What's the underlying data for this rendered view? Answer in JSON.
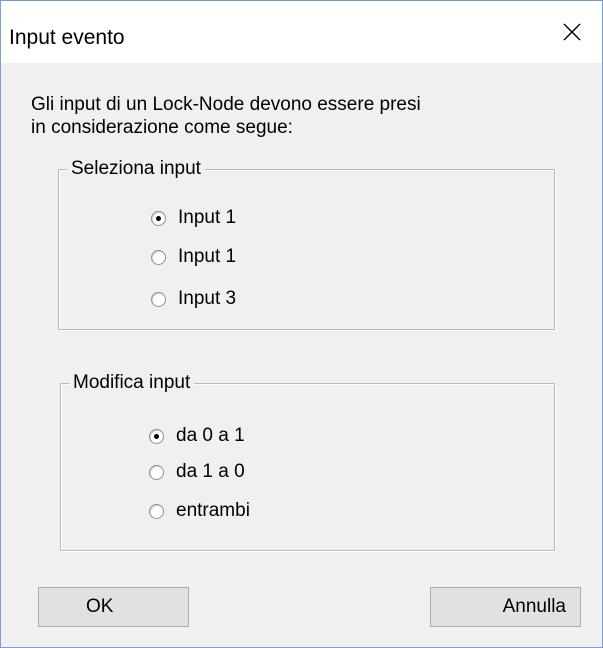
{
  "window": {
    "title": "Input evento",
    "close_icon": "close-icon"
  },
  "description": {
    "line1": "Gli input di un Lock-Node devono essere presi",
    "line2": "in considerazione come segue:"
  },
  "select_input": {
    "legend": "Seleziona input",
    "options": [
      {
        "label": "Input 1",
        "checked": true
      },
      {
        "label": "Input 1",
        "checked": false
      },
      {
        "label": "Input 3",
        "checked": false
      }
    ]
  },
  "modify_input": {
    "legend": "Modifica input",
    "options": [
      {
        "label": "da 0 a 1",
        "checked": true
      },
      {
        "label": "da 1 a 0",
        "checked": false
      },
      {
        "label": "entrambi",
        "checked": false
      }
    ]
  },
  "buttons": {
    "ok": "OK",
    "cancel": "Annulla"
  }
}
